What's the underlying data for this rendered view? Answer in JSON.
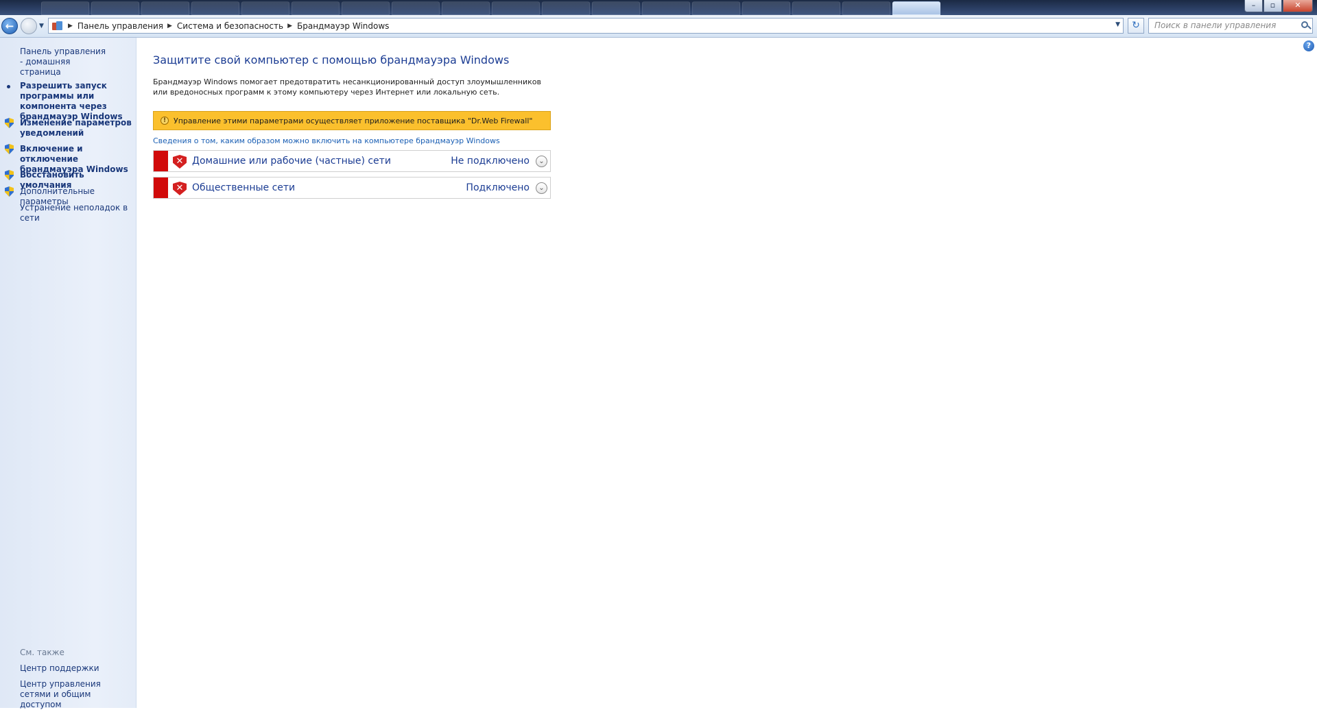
{
  "window": {
    "minimize_glyph": "–",
    "maximize_glyph": "▫",
    "close_glyph": "✕"
  },
  "nav": {
    "back_glyph": "←",
    "dropdown_glyph": "▼",
    "breadcrumb": [
      "Панель управления",
      "Система и безопасность",
      "Брандмауэр Windows"
    ],
    "address_dropdown_glyph": "▼",
    "refresh_glyph": "↻",
    "search_placeholder": "Поиск в панели управления"
  },
  "sidebar": {
    "home_link": "Панель управления - домашняя страница",
    "items": [
      {
        "label": "Разрешить запуск программы или компонента через брандмауэр Windows",
        "icon": "bullet"
      },
      {
        "label": "Изменение параметров уведомлений",
        "icon": "uac-shield-icon"
      },
      {
        "label": "Включение и отключение брандмауэра Windows",
        "icon": "uac-shield-icon"
      },
      {
        "label": "Восстановить умолчания",
        "icon": "uac-shield-icon"
      },
      {
        "label": "Дополнительные параметры",
        "icon": "uac-shield-icon"
      },
      {
        "label": "Устранение неполадок в сети",
        "icon": "none"
      }
    ],
    "see_also_header": "См. также",
    "see_also": [
      "Центр поддержки",
      "Центр управления сетями и общим доступом"
    ]
  },
  "main": {
    "title": "Защитите свой компьютер с помощью брандмауэра Windows",
    "description": "Брандмауэр Windows помогает предотвратить несанкционированный доступ злоумышленников или вредоносных программ к этому компьютеру через Интернет или локальную сеть.",
    "warning_glyph": "!",
    "warning_text": "Управление этими параметрами осуществляет приложение поставщика \"Dr.Web Firewall\"",
    "info_link": "Сведения о том, каким образом можно включить на компьютере брандмауэр Windows",
    "networks": [
      {
        "name": "Домашние или рабочие (частные) сети",
        "status": "Не подключено"
      },
      {
        "name": "Общественные сети",
        "status": "Подключено"
      }
    ],
    "network_icon_glyph": "✕",
    "expand_glyph": "⌄",
    "help_glyph": "?"
  },
  "colors": {
    "status_red": "#d10a0a",
    "warning_yellow": "#fbc02d",
    "link_blue": "#1b3c93"
  }
}
